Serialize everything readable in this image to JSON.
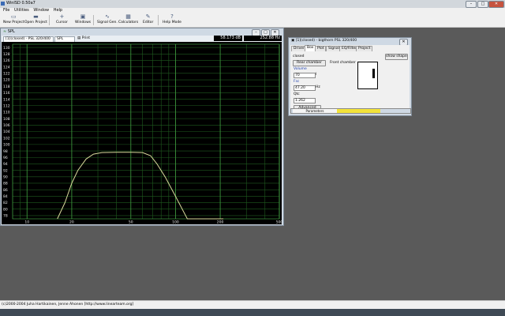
{
  "app": {
    "title": "WinISD 0.50a7"
  },
  "window_controls": {
    "min": "–",
    "max": "□",
    "close": "✕"
  },
  "menu": [
    "File",
    "Utilities",
    "Window",
    "Help"
  ],
  "toolbar": {
    "new_project": "New Project",
    "open_project": "Open Project",
    "cursor": "Cursor",
    "windows": "Windows",
    "signal_gen": "Signal Gen.",
    "calculators": "Calculators",
    "editor": "Editor",
    "help_mode": "Help Mode"
  },
  "spl_window": {
    "title": "SPL",
    "driver_select": "[1](closed) · PSL 320/400",
    "graph_select": "SPL",
    "print": "Print",
    "readout_db": "58.173 dB",
    "readout_hz": "252.88 Hz"
  },
  "chart_data": {
    "type": "line",
    "title": "",
    "xlabel": "",
    "ylabel": "",
    "x_scale": "log",
    "xlim": [
      8,
      500
    ],
    "ylim": [
      77,
      131
    ],
    "grid": true,
    "x_ticks": [
      10,
      20,
      50,
      100,
      200,
      500
    ],
    "y_ticks": [
      78,
      80,
      82,
      84,
      86,
      88,
      90,
      92,
      94,
      96,
      98,
      100,
      102,
      104,
      106,
      108,
      110,
      112,
      114,
      116,
      118,
      120,
      122,
      124,
      126,
      128,
      130
    ],
    "series": [
      {
        "color": "#d7d89a",
        "x": [
          16,
          18,
          20,
          22,
          25,
          28,
          32,
          40,
          50,
          60,
          68,
          75,
          85,
          100,
          120,
          150,
          180,
          210
        ],
        "y": [
          77,
          82,
          88,
          92,
          95.5,
          97,
          97.5,
          97.6,
          97.6,
          97.5,
          96.5,
          94,
          90,
          84,
          77,
          70,
          65,
          62
        ]
      }
    ]
  },
  "box_dialog": {
    "title": "[1](closed) - bigthorn PSL 320/400",
    "tabs": [
      "Driver",
      "Box",
      "Plot",
      "Signal",
      "EQ/Filter",
      "Project"
    ],
    "box_type": "closed",
    "show_shape": "show shape",
    "rear_chamber": "Rear chamber",
    "front_chamber": "Front chamber",
    "volume_label": "Volume",
    "volume_value": "70",
    "volume_unit": "l",
    "fsc_label": "Fsc",
    "fsc_value": "47.20",
    "fsc_unit": "Hz",
    "qtc_label": "Qtc",
    "qtc_value": "1.262",
    "advanced": "Advanced",
    "parameters": "Parameters",
    "status_fill": 0.59,
    "status_color": "#f2e33a"
  },
  "status_bar": {
    "copyright": "(c)2000-2004 Juha Hartikainen, Jenne Ahonen [http://www.linearteam.org]"
  }
}
